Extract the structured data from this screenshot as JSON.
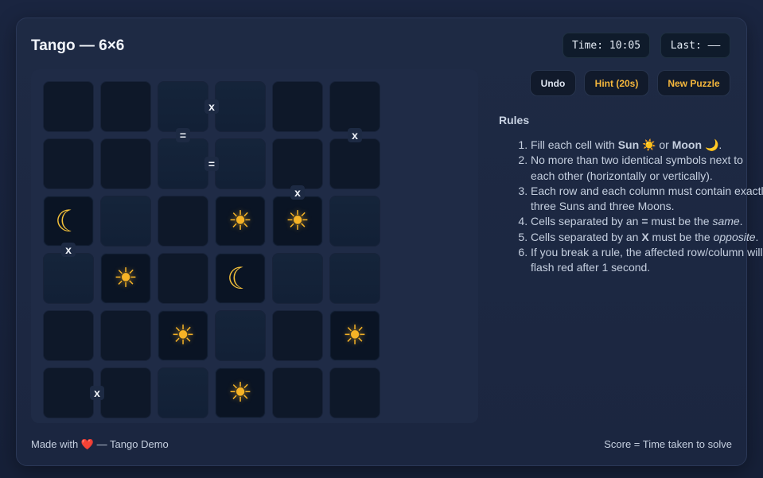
{
  "header": {
    "title": "Tango — 6×6",
    "time_label": "Time: 10:05",
    "last_label": "Last: ––"
  },
  "buttons": {
    "undo": "Undo",
    "hint": "Hint (20s)",
    "new_puzzle": "New Puzzle"
  },
  "symbols": {
    "sun": "☀",
    "moon": "☾",
    "equal": "=",
    "opposite": "x"
  },
  "board": {
    "size": 6,
    "cells": [
      [
        "",
        "",
        "",
        "",
        "",
        ""
      ],
      [
        "",
        "",
        "",
        "",
        "",
        ""
      ],
      [
        "moon",
        "",
        "",
        "sun",
        "sun",
        ""
      ],
      [
        "",
        "sun",
        "",
        "moon",
        "",
        ""
      ],
      [
        "",
        "",
        "sun",
        "",
        "",
        "sun"
      ],
      [
        "",
        "",
        "",
        "sun",
        "",
        ""
      ]
    ],
    "constraints": [
      {
        "between": [
          [
            0,
            2
          ],
          [
            0,
            3
          ]
        ],
        "type": "x"
      },
      {
        "between": [
          [
            0,
            2
          ],
          [
            1,
            2
          ]
        ],
        "type": "="
      },
      {
        "between": [
          [
            0,
            5
          ],
          [
            1,
            5
          ]
        ],
        "type": "x"
      },
      {
        "between": [
          [
            1,
            2
          ],
          [
            1,
            3
          ]
        ],
        "type": "="
      },
      {
        "between": [
          [
            1,
            4
          ],
          [
            2,
            4
          ]
        ],
        "type": "x"
      },
      {
        "between": [
          [
            2,
            0
          ],
          [
            3,
            0
          ]
        ],
        "type": "x"
      },
      {
        "between": [
          [
            5,
            0
          ],
          [
            5,
            1
          ]
        ],
        "type": "x"
      }
    ]
  },
  "rules": {
    "title": "Rules",
    "r1_a": "Fill each cell with ",
    "r1_sun": "Sun",
    "r1_sun_icon": "☀️",
    "r1_or": " or ",
    "r1_moon": "Moon",
    "r1_moon_icon": "🌙",
    "r1_end": ".",
    "r2": "No more than two identical symbols next to each other (horizontally or vertically).",
    "r3": "Each row and each column must contain exactly three Suns and three Moons.",
    "r4_a": "Cells separated by an ",
    "r4_sym": "=",
    "r4_b": " must be the ",
    "r4_c": "same",
    "r4_d": ".",
    "r5_a": "Cells separated by an ",
    "r5_sym": "X",
    "r5_b": " must be the ",
    "r5_c": "opposite",
    "r5_d": ".",
    "r6": "If you break a rule, the affected row/column will flash red after 1 second."
  },
  "footer": {
    "made_with": "Made with ",
    "heart": "❤️",
    "suffix": " — Tango Demo",
    "score": "Score = Time taken to solve"
  }
}
